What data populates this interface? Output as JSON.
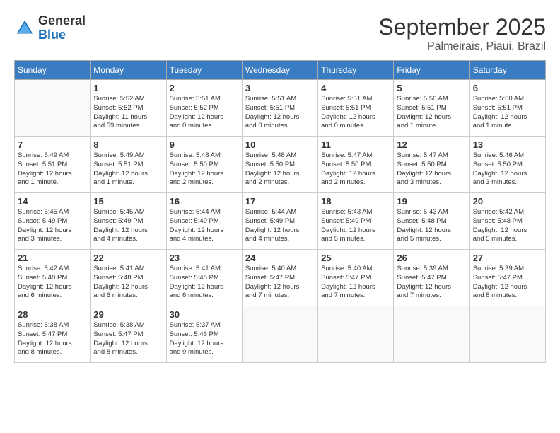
{
  "header": {
    "logo": {
      "general": "General",
      "blue": "Blue"
    },
    "month": "September 2025",
    "location": "Palmeirais, Piaui, Brazil"
  },
  "weekdays": [
    "Sunday",
    "Monday",
    "Tuesday",
    "Wednesday",
    "Thursday",
    "Friday",
    "Saturday"
  ],
  "weeks": [
    [
      {
        "day": "",
        "info": ""
      },
      {
        "day": "1",
        "info": "Sunrise: 5:52 AM\nSunset: 5:52 PM\nDaylight: 11 hours\nand 59 minutes."
      },
      {
        "day": "2",
        "info": "Sunrise: 5:51 AM\nSunset: 5:52 PM\nDaylight: 12 hours\nand 0 minutes."
      },
      {
        "day": "3",
        "info": "Sunrise: 5:51 AM\nSunset: 5:51 PM\nDaylight: 12 hours\nand 0 minutes."
      },
      {
        "day": "4",
        "info": "Sunrise: 5:51 AM\nSunset: 5:51 PM\nDaylight: 12 hours\nand 0 minutes."
      },
      {
        "day": "5",
        "info": "Sunrise: 5:50 AM\nSunset: 5:51 PM\nDaylight: 12 hours\nand 1 minute."
      },
      {
        "day": "6",
        "info": "Sunrise: 5:50 AM\nSunset: 5:51 PM\nDaylight: 12 hours\nand 1 minute."
      }
    ],
    [
      {
        "day": "7",
        "info": "Sunrise: 5:49 AM\nSunset: 5:51 PM\nDaylight: 12 hours\nand 1 minute."
      },
      {
        "day": "8",
        "info": "Sunrise: 5:49 AM\nSunset: 5:51 PM\nDaylight: 12 hours\nand 1 minute."
      },
      {
        "day": "9",
        "info": "Sunrise: 5:48 AM\nSunset: 5:50 PM\nDaylight: 12 hours\nand 2 minutes."
      },
      {
        "day": "10",
        "info": "Sunrise: 5:48 AM\nSunset: 5:50 PM\nDaylight: 12 hours\nand 2 minutes."
      },
      {
        "day": "11",
        "info": "Sunrise: 5:47 AM\nSunset: 5:50 PM\nDaylight: 12 hours\nand 2 minutes."
      },
      {
        "day": "12",
        "info": "Sunrise: 5:47 AM\nSunset: 5:50 PM\nDaylight: 12 hours\nand 3 minutes."
      },
      {
        "day": "13",
        "info": "Sunrise: 5:46 AM\nSunset: 5:50 PM\nDaylight: 12 hours\nand 3 minutes."
      }
    ],
    [
      {
        "day": "14",
        "info": "Sunrise: 5:45 AM\nSunset: 5:49 PM\nDaylight: 12 hours\nand 3 minutes."
      },
      {
        "day": "15",
        "info": "Sunrise: 5:45 AM\nSunset: 5:49 PM\nDaylight: 12 hours\nand 4 minutes."
      },
      {
        "day": "16",
        "info": "Sunrise: 5:44 AM\nSunset: 5:49 PM\nDaylight: 12 hours\nand 4 minutes."
      },
      {
        "day": "17",
        "info": "Sunrise: 5:44 AM\nSunset: 5:49 PM\nDaylight: 12 hours\nand 4 minutes."
      },
      {
        "day": "18",
        "info": "Sunrise: 5:43 AM\nSunset: 5:49 PM\nDaylight: 12 hours\nand 5 minutes."
      },
      {
        "day": "19",
        "info": "Sunrise: 5:43 AM\nSunset: 5:48 PM\nDaylight: 12 hours\nand 5 minutes."
      },
      {
        "day": "20",
        "info": "Sunrise: 5:42 AM\nSunset: 5:48 PM\nDaylight: 12 hours\nand 5 minutes."
      }
    ],
    [
      {
        "day": "21",
        "info": "Sunrise: 5:42 AM\nSunset: 5:48 PM\nDaylight: 12 hours\nand 6 minutes."
      },
      {
        "day": "22",
        "info": "Sunrise: 5:41 AM\nSunset: 5:48 PM\nDaylight: 12 hours\nand 6 minutes."
      },
      {
        "day": "23",
        "info": "Sunrise: 5:41 AM\nSunset: 5:48 PM\nDaylight: 12 hours\nand 6 minutes."
      },
      {
        "day": "24",
        "info": "Sunrise: 5:40 AM\nSunset: 5:47 PM\nDaylight: 12 hours\nand 7 minutes."
      },
      {
        "day": "25",
        "info": "Sunrise: 5:40 AM\nSunset: 5:47 PM\nDaylight: 12 hours\nand 7 minutes."
      },
      {
        "day": "26",
        "info": "Sunrise: 5:39 AM\nSunset: 5:47 PM\nDaylight: 12 hours\nand 7 minutes."
      },
      {
        "day": "27",
        "info": "Sunrise: 5:39 AM\nSunset: 5:47 PM\nDaylight: 12 hours\nand 8 minutes."
      }
    ],
    [
      {
        "day": "28",
        "info": "Sunrise: 5:38 AM\nSunset: 5:47 PM\nDaylight: 12 hours\nand 8 minutes."
      },
      {
        "day": "29",
        "info": "Sunrise: 5:38 AM\nSunset: 5:47 PM\nDaylight: 12 hours\nand 8 minutes."
      },
      {
        "day": "30",
        "info": "Sunrise: 5:37 AM\nSunset: 5:46 PM\nDaylight: 12 hours\nand 9 minutes."
      },
      {
        "day": "",
        "info": ""
      },
      {
        "day": "",
        "info": ""
      },
      {
        "day": "",
        "info": ""
      },
      {
        "day": "",
        "info": ""
      }
    ]
  ]
}
